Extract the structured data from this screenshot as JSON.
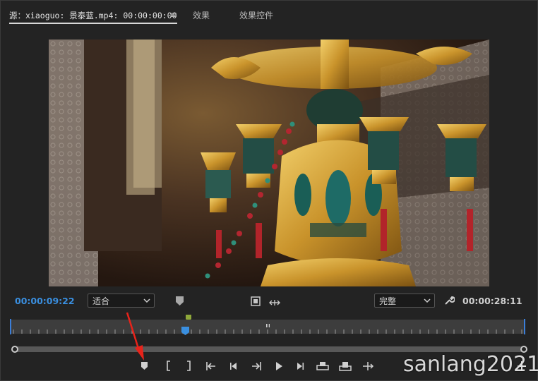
{
  "tabs": {
    "source": "源：xiaoguo: 景泰蓝.mp4: 00:00:00:00",
    "menu_glyph": "≡",
    "effects": "效果",
    "effect_controls": "效果控件"
  },
  "monitor": {
    "current_timecode": "00:00:09:22",
    "fit": "适合",
    "resolution": "完整",
    "duration_timecode": "00:00:28:11",
    "playhead_fraction": 0.34
  },
  "icons": {
    "marker": "marker-icon",
    "export_frame": "film-frame-icon",
    "settings": "wrench-icon"
  },
  "transport": [
    "add-marker",
    "mark-in",
    "mark-out",
    "go-to-in",
    "step-back",
    "play",
    "step-forward",
    "go-to-out",
    "insert",
    "overwrite",
    "export-frame"
  ],
  "watermark": "sanlang2021",
  "colors": {
    "accent": "#3a8fe0",
    "annotation": "#e8231a",
    "in_marker": "#8fa83a"
  }
}
